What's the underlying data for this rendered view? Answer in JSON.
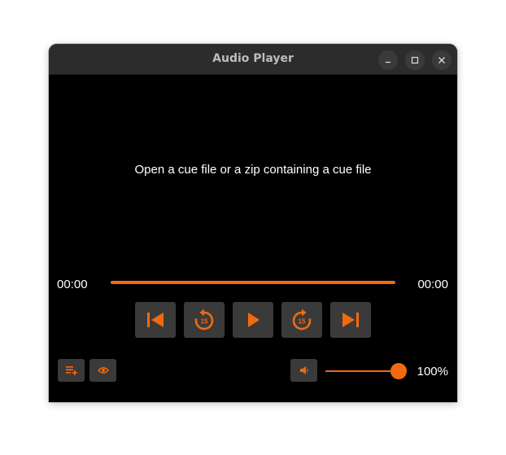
{
  "window": {
    "title": "Audio Player"
  },
  "player": {
    "message": "Open a cue file or a zip containing a cue file",
    "elapsed": "00:00",
    "duration": "00:00",
    "volume_label": "100%",
    "volume_level": 1.0,
    "skip_seconds": "15",
    "accent_color": "#f26a0f"
  },
  "icons": {
    "titlebar": [
      "minimize-icon",
      "maximize-icon",
      "close-icon"
    ],
    "transport": [
      "skip-previous-icon",
      "rewind-15-icon",
      "play-icon",
      "forward-15-icon",
      "skip-next-icon"
    ],
    "bottom": [
      "playlist-add-icon",
      "eye-icon",
      "volume-icon"
    ]
  }
}
